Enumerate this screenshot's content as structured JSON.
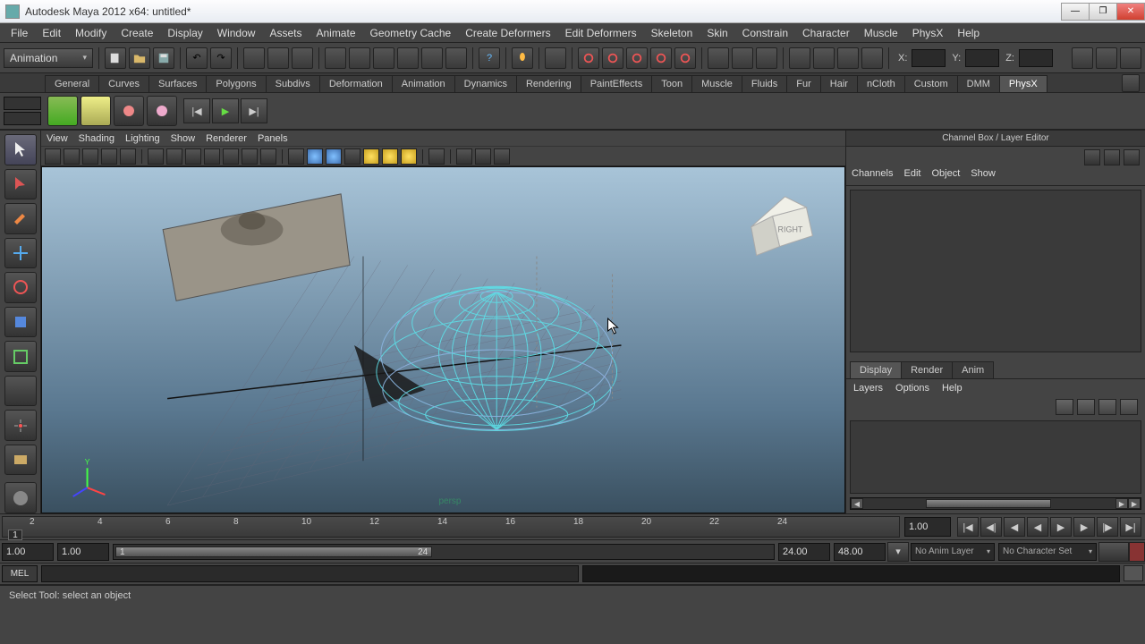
{
  "window": {
    "title": "Autodesk Maya 2012 x64: untitled*"
  },
  "menus": [
    "File",
    "Edit",
    "Modify",
    "Create",
    "Display",
    "Window",
    "Assets",
    "Animate",
    "Geometry Cache",
    "Create Deformers",
    "Edit Deformers",
    "Skeleton",
    "Skin",
    "Constrain",
    "Character",
    "Muscle",
    "PhysX",
    "Help"
  ],
  "mode_dropdown": "Animation",
  "coords": {
    "x": "X:",
    "y": "Y:",
    "z": "Z:"
  },
  "shelf_tabs": [
    "General",
    "Curves",
    "Surfaces",
    "Polygons",
    "Subdivs",
    "Deformation",
    "Animation",
    "Dynamics",
    "Rendering",
    "PaintEffects",
    "Toon",
    "Muscle",
    "Fluids",
    "Fur",
    "Hair",
    "nCloth",
    "Custom",
    "DMM",
    "PhysX"
  ],
  "shelf_active": "PhysX",
  "viewport_menus": [
    "View",
    "Shading",
    "Lighting",
    "Show",
    "Renderer",
    "Panels"
  ],
  "viewcube_face": "RIGHT",
  "axis_labels": {
    "y": "Y"
  },
  "channel_box": {
    "title": "Channel Box / Layer Editor",
    "tabs": [
      "Channels",
      "Edit",
      "Object",
      "Show"
    ],
    "lower_tabs": [
      "Display",
      "Render",
      "Anim"
    ],
    "lower_active": "Display",
    "layer_menu": [
      "Layers",
      "Options",
      "Help"
    ]
  },
  "timeline": {
    "ticks": [
      "2",
      "4",
      "6",
      "8",
      "10",
      "12",
      "14",
      "16",
      "18",
      "20",
      "22",
      "24"
    ],
    "current_marker": "1",
    "current_field": "1.00"
  },
  "range": {
    "start_outer": "1.00",
    "start_inner": "1.00",
    "bar_left": "1",
    "bar_right": "24",
    "end_inner": "24.00",
    "end_outer": "48.00",
    "anim_layer": "No Anim Layer",
    "char_set": "No Character Set"
  },
  "cmd": {
    "label": "MEL"
  },
  "status": "Select Tool: select an object"
}
